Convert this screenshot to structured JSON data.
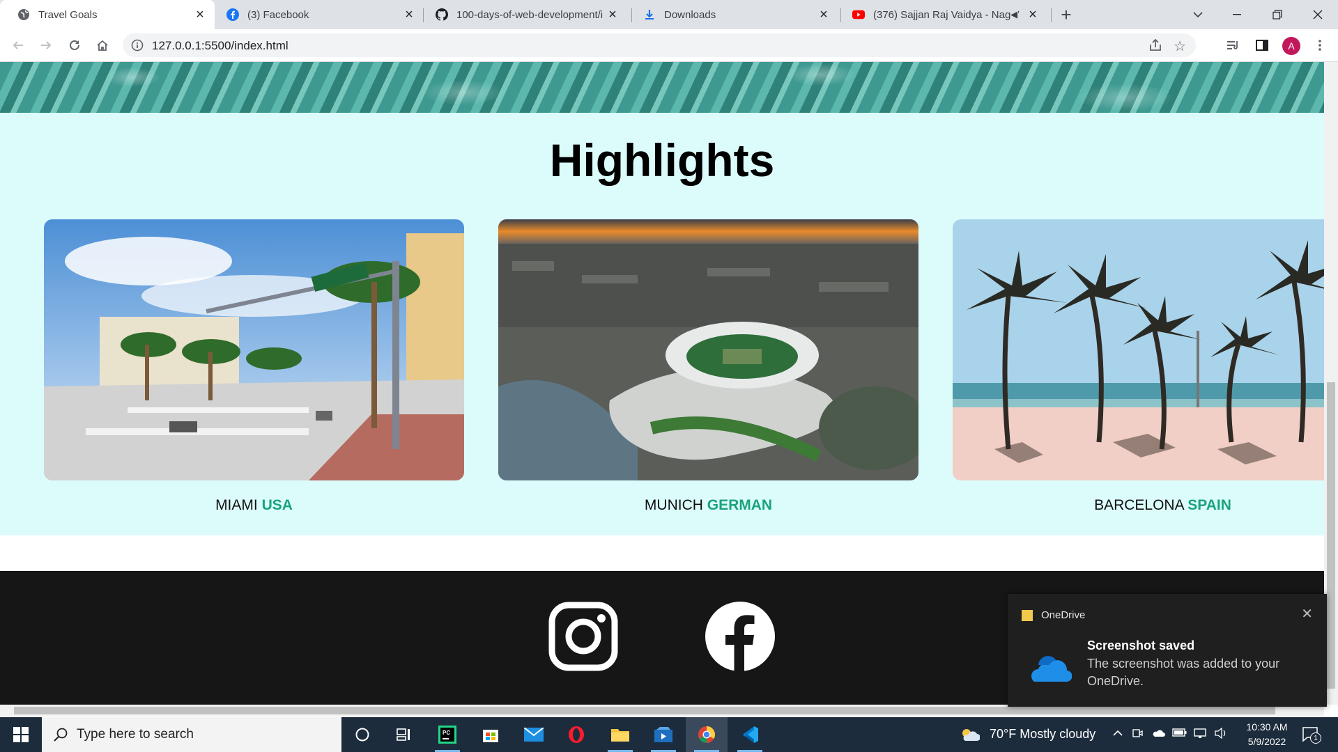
{
  "browser": {
    "tabs": [
      {
        "title": "Travel Goals",
        "icon": "globe-icon",
        "active": true
      },
      {
        "title": "(3) Facebook",
        "icon": "facebook-icon",
        "active": false
      },
      {
        "title": "100-days-of-web-development/i",
        "icon": "github-icon",
        "active": false
      },
      {
        "title": "Downloads",
        "icon": "download-icon",
        "active": false
      },
      {
        "title": "(376) Sajjan Raj Vaidya - Nag",
        "icon": "youtube-icon",
        "active": false
      }
    ],
    "url": "127.0.0.1:5500/index.html",
    "profile_initial": "A"
  },
  "page": {
    "highlights_title": "Highlights",
    "cards": [
      {
        "city": "MIAMI",
        "country": "USA"
      },
      {
        "city": "MUNICH",
        "country": "GERMAN"
      },
      {
        "city": "BARCELONA",
        "country": "SPAIN"
      }
    ],
    "footer_icons": [
      "instagram-icon",
      "facebook-icon"
    ],
    "accent_color": "#1aa37a",
    "section_bg": "#dcfcfb",
    "footer_bg": "#161616"
  },
  "toast": {
    "app": "OneDrive",
    "title": "Screenshot saved",
    "body": "The screenshot was added to your OneDrive."
  },
  "taskbar": {
    "search_placeholder": "Type here to search",
    "weather": "70°F  Mostly cloudy",
    "time": "10:30 AM",
    "date": "5/9/2022",
    "notification_count": "1"
  }
}
